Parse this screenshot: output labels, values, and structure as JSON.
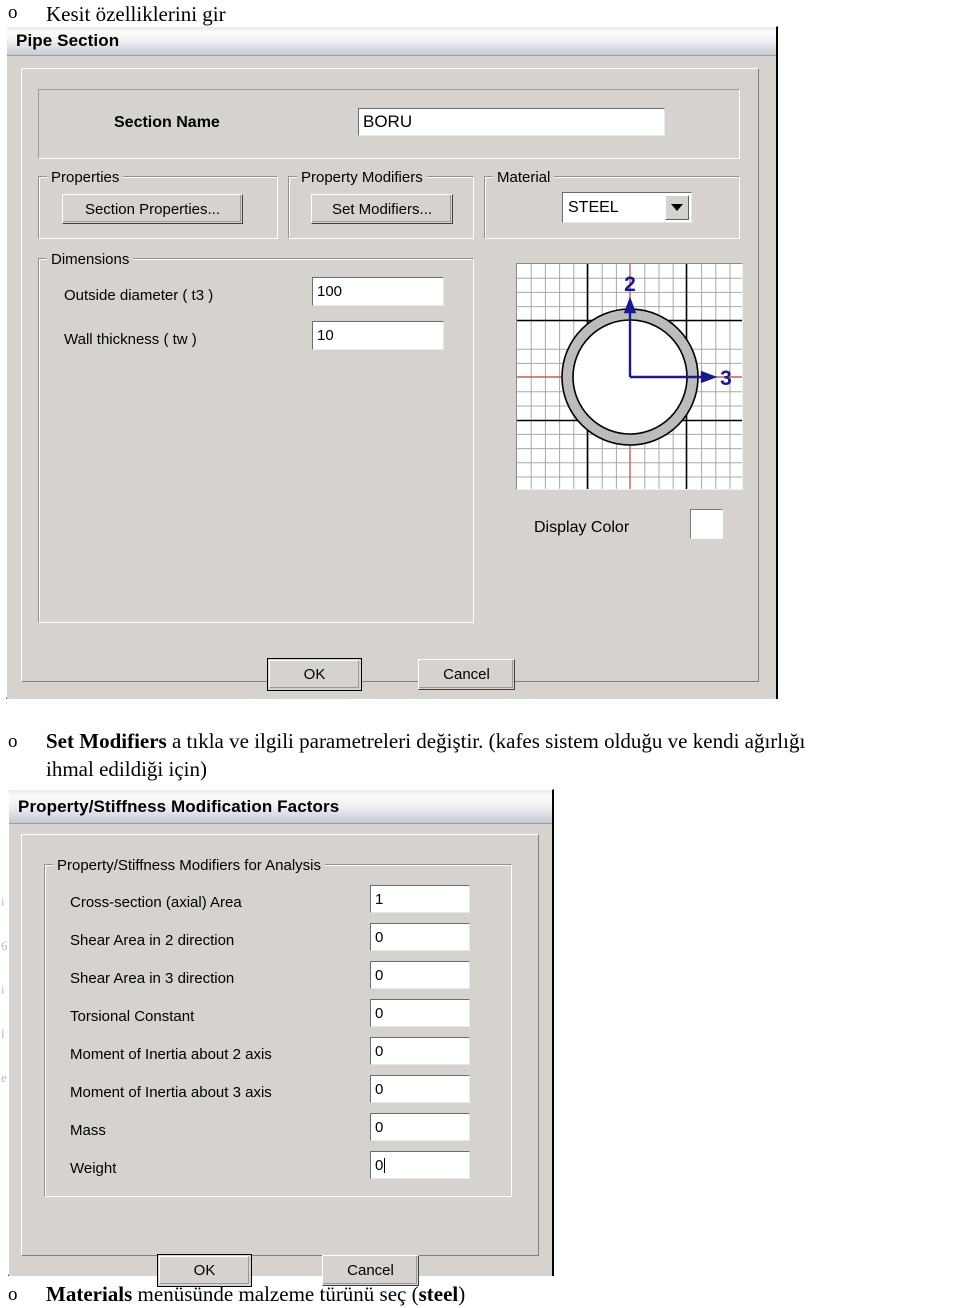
{
  "document": {
    "bullet_glyph": "o",
    "line1": "Kesit özelliklerini gir",
    "line2_prefix": "Set Modifiers",
    "line2_rest": " a tıkla ve ilgili parametreleri değiştir. (kafes sistem olduğu ve kendi ağırlığı",
    "line2_cont": "ihmal edildiği için)",
    "line3_prefix": "Materials",
    "line3_mid": " menüsünde malzeme türünü seç (",
    "line3_bold_end": "steel",
    "line3_suffix": ")"
  },
  "pipe_dialog": {
    "title": "Pipe Section",
    "section_name_label": "Section Name",
    "section_name_value": "BORU",
    "properties_group": "Properties",
    "section_properties_button": "Section Properties...",
    "property_modifiers_group": "Property Modifiers",
    "set_modifiers_button": "Set Modifiers...",
    "material_group": "Material",
    "material_value": "STEEL",
    "dimensions_group": "Dimensions",
    "outside_diameter_label": "Outside diameter  ( t3 )",
    "outside_diameter_value": "100",
    "wall_thickness_label": "Wall thickness  ( tw )",
    "wall_thickness_value": "10",
    "display_color_label": "Display Color",
    "display_color_value": "#ffffff",
    "ok_button": "OK",
    "cancel_button": "Cancel",
    "preview": {
      "axis_2_label": "2",
      "axis_3_label": "3",
      "axis_color": "#1a1a8c",
      "crosshair_color": "#c24a4a",
      "pipe_fill": "#b8b8b8",
      "pipe_stroke": "#000000",
      "grid_minor_color": "#b0b0b0",
      "grid_major_color": "#000000"
    }
  },
  "modifiers_dialog": {
    "title": "Property/Stiffness Modification Factors",
    "group_caption": "Property/Stiffness Modifiers for Analysis",
    "rows": [
      {
        "label": "Cross-section (axial) Area",
        "value": "1"
      },
      {
        "label": "Shear Area in 2 direction",
        "value": "0"
      },
      {
        "label": "Shear Area in 3 direction",
        "value": "0"
      },
      {
        "label": "Torsional Constant",
        "value": "0"
      },
      {
        "label": "Moment of Inertia about 2 axis",
        "value": "0"
      },
      {
        "label": "Moment of Inertia about 3 axis",
        "value": "0"
      },
      {
        "label": "Mass",
        "value": "0"
      },
      {
        "label": "Weight",
        "value": "0"
      }
    ],
    "focused_row_index": 7,
    "ok_button": "OK",
    "cancel_button": "Cancel"
  }
}
